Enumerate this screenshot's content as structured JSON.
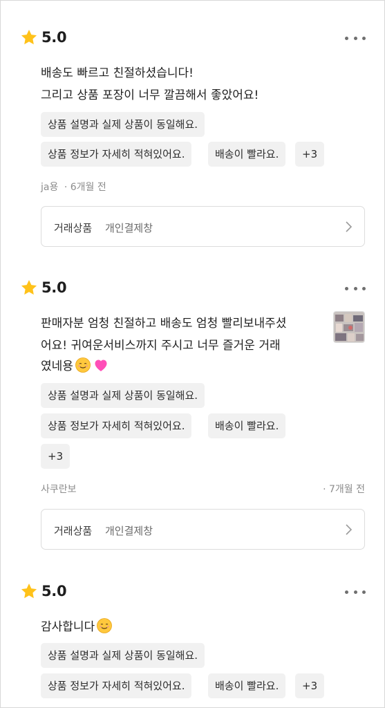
{
  "reviews": [
    {
      "rating": "5.0",
      "lines": [
        "배송도 빠르고 친절하셨습니다!",
        "그리고 상품 포장이 너무 깔끔해서 좋았어요!"
      ],
      "tags": [
        "상품 설명과 실제 상품이 동일해요.",
        "상품 정보가 자세히 적혀있어요.",
        "배송이 빨라요.",
        "+3"
      ],
      "author": "ja용",
      "time": "· 6개월 전",
      "product_label": "거래상품",
      "product_value": "개인결제창"
    },
    {
      "rating": "5.0",
      "lines": [
        "판매자분 엄청 친절하고 배송도 엄청 빨리보내주셨",
        "어요! 귀여운서비스까지 주시고 너무 즐거운 거래",
        "였네용"
      ],
      "tags": [
        "상품 설명과 실제 상품이 동일해요.",
        "상품 정보가 자세히 적혀있어요.",
        "배송이 빨라요.",
        "+3"
      ],
      "author": "사쿠란보",
      "time": "· 7개월 전",
      "product_label": "거래상품",
      "product_value": "개인결제창",
      "emojis": [
        "smiling-face-icon",
        "pink-heart-icon"
      ]
    },
    {
      "rating": "5.0",
      "lines": [
        "감사합니다"
      ],
      "tags": [
        "상품 설명과 실제 상품이 동일해요.",
        "상품 정보가 자세히 적혀있어요.",
        "배송이 빨라요.",
        "+3"
      ],
      "emojis": [
        "smiling-face-icon"
      ]
    }
  ],
  "colors": {
    "star": "#FFC21A",
    "tag_bg": "#F1F1F1",
    "meta": "#8C8C8C"
  },
  "icons": {
    "rating": "star-icon",
    "menu": "more-dots-icon",
    "chevron": "chevron-right-icon"
  }
}
